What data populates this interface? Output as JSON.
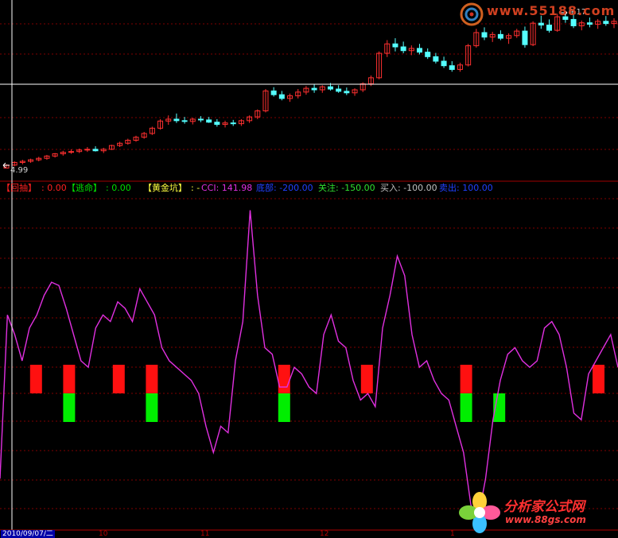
{
  "price_panel": {
    "low_label": "4.99",
    "high_label": "9.17",
    "watermark_top": "www.55188.com",
    "watermark_digit": "5"
  },
  "indicator_legend": {
    "item1_name": "【回抽】",
    "item1_value": ": 0.00",
    "item2_name": "【逃命】",
    "item2_value": ": 0.00",
    "item3_name": "【黄金坑】",
    "item3_value": ": -",
    "cci_text": "CCI: 141.98",
    "dibu_text": "底部: -200.00",
    "guanzhu_text": "关注: -150.00",
    "mairu_text": "买入: -100.00",
    "maichu_text": "卖出: 100.00"
  },
  "time_axis": {
    "date_label": "2010/09/07/二",
    "month_labels": [
      "10",
      "11",
      "12",
      "1"
    ]
  },
  "watermark_bottom": {
    "brand": "分析家公式网",
    "url": "www.88gs.com"
  },
  "colors": {
    "background": "#000000",
    "rise": "#ff3030",
    "fall": "#54ffff",
    "cci_line": "#e030e0",
    "red_signal": "#ff1010",
    "green_signal": "#00ee00",
    "grid": "#800000",
    "crosshair": "#ffffff"
  },
  "chart_data": {
    "type": "candlestick",
    "y_range": [
      4.99,
      9.17
    ],
    "candles": [
      [
        5.0,
        5.1,
        4.99,
        5.08
      ],
      [
        5.08,
        5.18,
        5.05,
        5.15
      ],
      [
        5.15,
        5.22,
        5.1,
        5.18
      ],
      [
        5.18,
        5.25,
        5.14,
        5.22
      ],
      [
        5.22,
        5.3,
        5.18,
        5.26
      ],
      [
        5.26,
        5.35,
        5.22,
        5.32
      ],
      [
        5.32,
        5.4,
        5.28,
        5.38
      ],
      [
        5.38,
        5.46,
        5.33,
        5.42
      ],
      [
        5.42,
        5.5,
        5.38,
        5.44
      ],
      [
        5.44,
        5.52,
        5.4,
        5.48
      ],
      [
        5.48,
        5.56,
        5.43,
        5.5
      ],
      [
        5.5,
        5.58,
        5.44,
        5.46
      ],
      [
        5.46,
        5.54,
        5.4,
        5.5
      ],
      [
        5.5,
        5.62,
        5.48,
        5.6
      ],
      [
        5.6,
        5.7,
        5.56,
        5.66
      ],
      [
        5.66,
        5.78,
        5.62,
        5.74
      ],
      [
        5.74,
        5.86,
        5.7,
        5.82
      ],
      [
        5.82,
        5.96,
        5.78,
        5.92
      ],
      [
        5.92,
        6.1,
        5.88,
        6.06
      ],
      [
        6.06,
        6.3,
        6.02,
        6.25
      ],
      [
        6.25,
        6.4,
        6.15,
        6.3
      ],
      [
        6.3,
        6.45,
        6.2,
        6.26
      ],
      [
        6.26,
        6.36,
        6.18,
        6.24
      ],
      [
        6.24,
        6.34,
        6.16,
        6.3
      ],
      [
        6.3,
        6.38,
        6.22,
        6.28
      ],
      [
        6.28,
        6.36,
        6.2,
        6.22
      ],
      [
        6.22,
        6.3,
        6.1,
        6.16
      ],
      [
        6.16,
        6.26,
        6.08,
        6.2
      ],
      [
        6.2,
        6.28,
        6.12,
        6.18
      ],
      [
        6.18,
        6.3,
        6.12,
        6.26
      ],
      [
        6.26,
        6.4,
        6.2,
        6.36
      ],
      [
        6.36,
        6.56,
        6.3,
        6.52
      ],
      [
        6.52,
        7.1,
        6.48,
        7.05
      ],
      [
        7.05,
        7.15,
        6.9,
        6.95
      ],
      [
        6.95,
        7.05,
        6.8,
        6.85
      ],
      [
        6.85,
        6.98,
        6.76,
        6.92
      ],
      [
        6.92,
        7.1,
        6.85,
        7.02
      ],
      [
        7.02,
        7.18,
        6.95,
        7.12
      ],
      [
        7.12,
        7.22,
        7.0,
        7.08
      ],
      [
        7.08,
        7.2,
        7.0,
        7.16
      ],
      [
        7.16,
        7.26,
        7.06,
        7.1
      ],
      [
        7.1,
        7.2,
        7.0,
        7.04
      ],
      [
        7.04,
        7.14,
        6.94,
        7.0
      ],
      [
        7.0,
        7.12,
        6.92,
        7.08
      ],
      [
        7.08,
        7.28,
        7.02,
        7.24
      ],
      [
        7.24,
        7.46,
        7.18,
        7.4
      ],
      [
        7.4,
        8.1,
        7.36,
        8.05
      ],
      [
        8.05,
        8.4,
        7.95,
        8.3
      ],
      [
        8.3,
        8.45,
        8.1,
        8.22
      ],
      [
        8.22,
        8.36,
        8.05,
        8.12
      ],
      [
        8.12,
        8.26,
        8.0,
        8.18
      ],
      [
        8.18,
        8.3,
        8.02,
        8.08
      ],
      [
        8.08,
        8.18,
        7.9,
        7.96
      ],
      [
        7.96,
        8.06,
        7.78,
        7.84
      ],
      [
        7.84,
        7.96,
        7.66,
        7.72
      ],
      [
        7.72,
        7.84,
        7.56,
        7.62
      ],
      [
        7.62,
        7.8,
        7.56,
        7.74
      ],
      [
        7.74,
        8.3,
        7.7,
        8.25
      ],
      [
        8.25,
        8.7,
        8.2,
        8.6
      ],
      [
        8.6,
        8.74,
        8.4,
        8.48
      ],
      [
        8.48,
        8.62,
        8.35,
        8.55
      ],
      [
        8.55,
        8.66,
        8.4,
        8.45
      ],
      [
        8.45,
        8.58,
        8.3,
        8.52
      ],
      [
        8.52,
        8.7,
        8.46,
        8.64
      ],
      [
        8.64,
        8.76,
        8.2,
        8.28
      ],
      [
        8.28,
        8.9,
        8.24,
        8.85
      ],
      [
        8.85,
        9.05,
        8.7,
        8.8
      ],
      [
        8.8,
        8.95,
        8.6,
        8.66
      ],
      [
        8.66,
        9.1,
        8.62,
        9.02
      ],
      [
        9.02,
        9.17,
        8.86,
        8.95
      ],
      [
        8.95,
        9.08,
        8.72,
        8.78
      ],
      [
        8.78,
        8.92,
        8.66,
        8.86
      ],
      [
        8.86,
        9.0,
        8.74,
        8.82
      ],
      [
        8.82,
        8.96,
        8.7,
        8.9
      ],
      [
        8.9,
        9.04,
        8.78,
        8.84
      ],
      [
        8.84,
        8.98,
        8.72,
        8.9
      ]
    ],
    "cci": [
      -160,
      90,
      60,
      20,
      70,
      90,
      120,
      140,
      135,
      100,
      60,
      20,
      10,
      70,
      90,
      80,
      110,
      100,
      80,
      130,
      110,
      90,
      40,
      20,
      10,
      0,
      -10,
      -30,
      -80,
      -120,
      -80,
      -90,
      20,
      80,
      250,
      120,
      40,
      30,
      -20,
      -20,
      10,
      0,
      -20,
      -30,
      60,
      90,
      50,
      40,
      -10,
      -40,
      -30,
      -50,
      70,
      120,
      180,
      150,
      60,
      10,
      20,
      -10,
      -30,
      -40,
      -80,
      -120,
      -200,
      -220,
      -160,
      -70,
      -10,
      30,
      40,
      20,
      10,
      20,
      70,
      80,
      60,
      10,
      -60,
      -70,
      0,
      20,
      40,
      60,
      10
    ],
    "cci_range": [
      -230,
      270
    ],
    "red_signals": [
      1,
      3,
      6,
      8,
      16,
      21,
      27,
      35
    ],
    "green_signals": [
      3,
      8,
      16,
      27,
      29
    ]
  }
}
